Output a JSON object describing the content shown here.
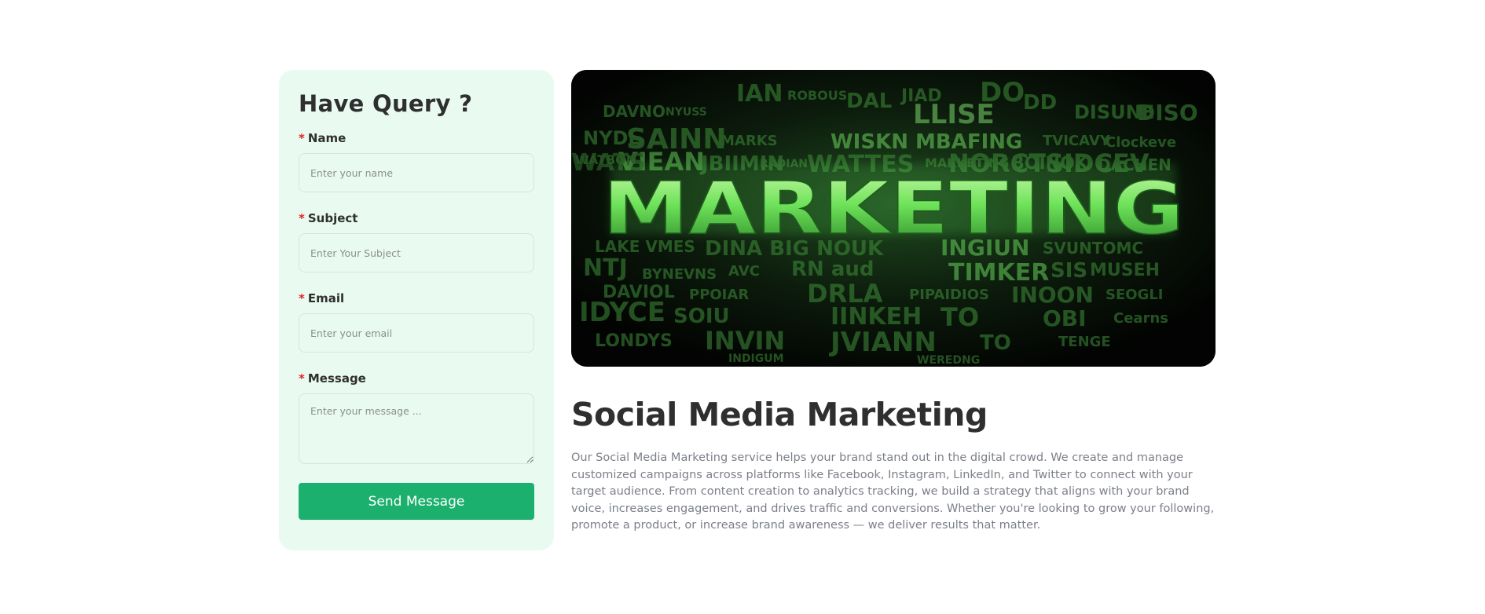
{
  "contact_form": {
    "title": "Have Query ?",
    "required_marker": "*",
    "name": {
      "label": "Name",
      "placeholder": "Enter your name"
    },
    "subject": {
      "label": "Subject",
      "placeholder": "Enter Your Subject"
    },
    "email": {
      "label": "Email",
      "placeholder": "Enter your email"
    },
    "message": {
      "label": "Message",
      "placeholder": "Enter your message ..."
    },
    "submit_label": "Send Message"
  },
  "banner": {
    "headline": "MARKETING",
    "accent_color": "#5be35a"
  },
  "article": {
    "title": "Social Media Marketing",
    "body": "Our Social Media Marketing service helps your brand stand out in the digital crowd. We create and manage customized campaigns across platforms like Facebook, Instagram, LinkedIn, and Twitter to connect with your target audience. From content creation to analytics tracking, we build a strategy that aligns with your brand voice, increases engagement, and drives traffic and conversions. Whether you're looking to grow your following, promote a product, or increase brand awareness — we deliver results that matter."
  },
  "colors": {
    "card_background": "#e9fbf1",
    "button": "#1bb06d",
    "required": "#e02424"
  }
}
